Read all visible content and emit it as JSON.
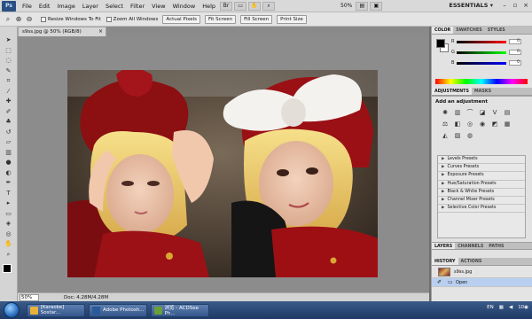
{
  "menu": {
    "logo": "Ps",
    "items": [
      "File",
      "Edit",
      "Image",
      "Layer",
      "Select",
      "Filter",
      "View",
      "Window",
      "Help"
    ],
    "zoom": "50%",
    "workspace": "ESSENTIALS ▾"
  },
  "options": {
    "resize_windows": "Resize Windows To Fit",
    "zoom_all": "Zoom All Windows",
    "actual_pixels": "Actual Pixels",
    "fit_screen": "Fit Screen",
    "fill_screen": "Fill Screen",
    "print_size": "Print Size"
  },
  "document": {
    "tab_title": "s9ss.jpg @ 50% (RGB/8)",
    "zoom": "50%",
    "doc_info": "Doc: 4.28M/4.28M"
  },
  "color_panel": {
    "tabs": [
      "COLOR",
      "SWATCHES",
      "STYLES"
    ],
    "r_label": "R",
    "g_label": "G",
    "b_label": "B",
    "r": "0",
    "g": "0",
    "b": "0"
  },
  "adjustments": {
    "tabs": [
      "ADJUSTMENTS",
      "MASKS"
    ],
    "title": "Add an adjustment",
    "presets": [
      "Levels Presets",
      "Curves Presets",
      "Exposure Presets",
      "Hue/Saturation Presets",
      "Black & White Presets",
      "Channel Mixer Presets",
      "Selective Color Presets"
    ]
  },
  "layers_tabs": [
    "LAYERS",
    "CHANNELS",
    "PATHS"
  ],
  "history": {
    "tabs": [
      "HISTORY",
      "ACTIONS"
    ],
    "snapshot": "s9ss.jpg",
    "state": "Open"
  },
  "taskbar": {
    "buttons": [
      "[Karaoke] Sostar...",
      "Adobe Photosh...",
      "浏览 - ACDSee Ph..."
    ],
    "lang": "EN",
    "time": "10◉"
  }
}
